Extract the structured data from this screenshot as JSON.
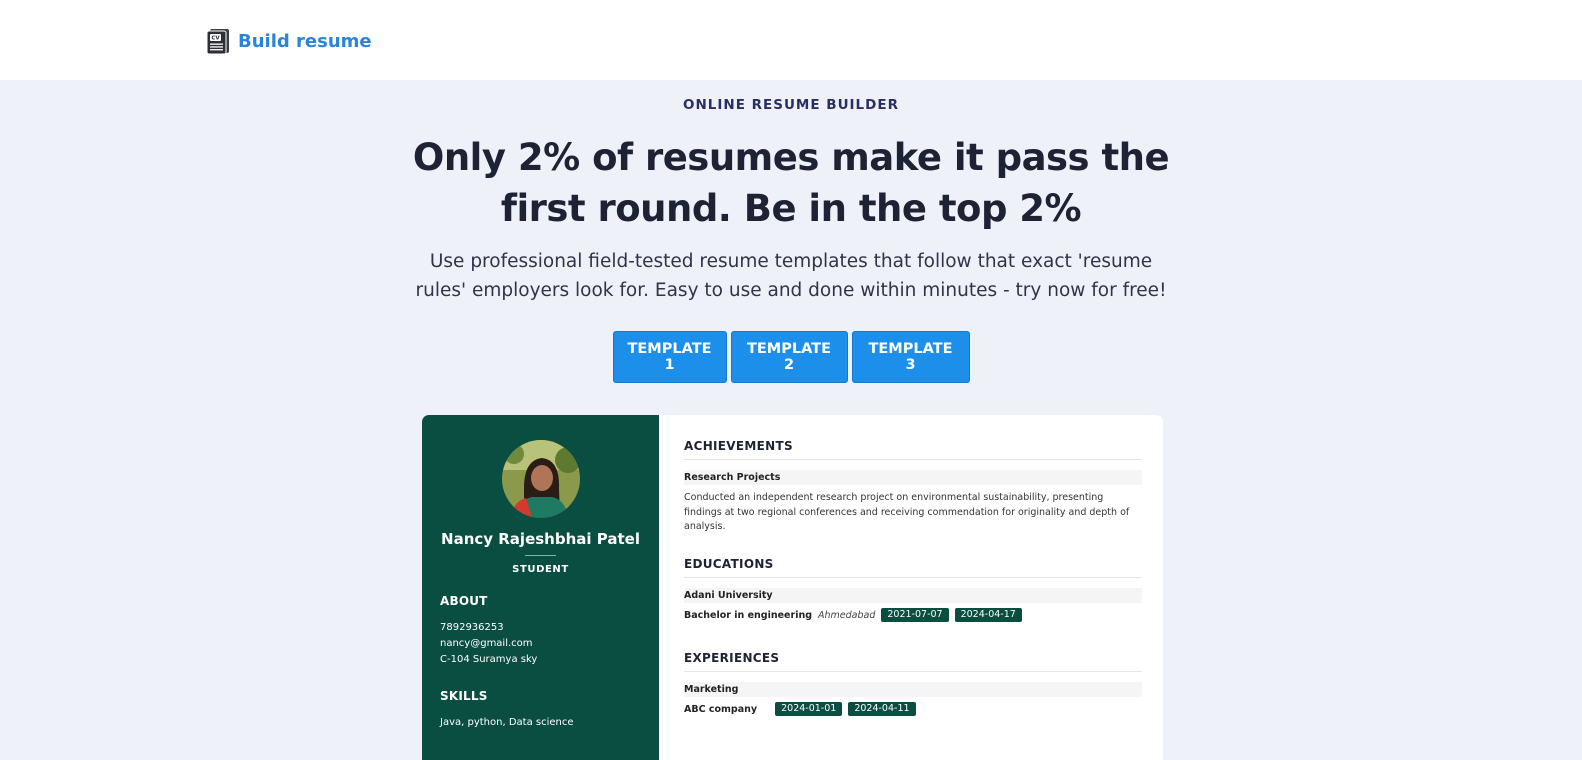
{
  "nav": {
    "brand_label": "Build resume",
    "brand_icon": "cv-document-icon",
    "brand_color": "#2a84db"
  },
  "hero": {
    "eyebrow": "ONLINE RESUME BUILDER",
    "headline_line1": "Only 2% of resumes make it pass the",
    "headline_line2": "first round. Be in the top 2%",
    "subtext_line1": "Use professional field-tested resume templates that follow that exact 'resume",
    "subtext_line2": "rules' employers look for. Easy to use and done within minutes - try now for free!"
  },
  "templates": {
    "btn1": "TEMPLATE 1",
    "btn2": "TEMPLATE 2",
    "btn3": "TEMPLATE 3",
    "accent": "#1c8fea"
  },
  "resume": {
    "sidebar_color": "#0a4e42",
    "name": "Nancy Rajeshbhai Patel",
    "role": "STUDENT",
    "about": {
      "heading": "ABOUT",
      "phone": "7892936253",
      "email": "nancy@gmail.com",
      "address": "C-104 Suramya sky"
    },
    "skills": {
      "heading": "SKILLS",
      "list": "Java, python, Data science"
    },
    "achievements": {
      "heading": "ACHIEVEMENTS",
      "title": "Research Projects",
      "desc_line1": "Conducted an independent research project on environmental sustainability, presenting",
      "desc_line2": "findings at two regional conferences and receiving commendation for originality and depth of",
      "desc_line3": "analysis."
    },
    "educations": {
      "heading": "EDUCATIONS",
      "school": "Adani University",
      "degree": "Bachelor in engineering",
      "location": "Ahmedabad",
      "start": "2021-07-07",
      "end": "2024-04-17"
    },
    "experiences": {
      "heading": "EXPERIENCES",
      "title": "Marketing",
      "company": "ABC company",
      "start": "2024-01-01",
      "end": "2024-04-11"
    }
  }
}
